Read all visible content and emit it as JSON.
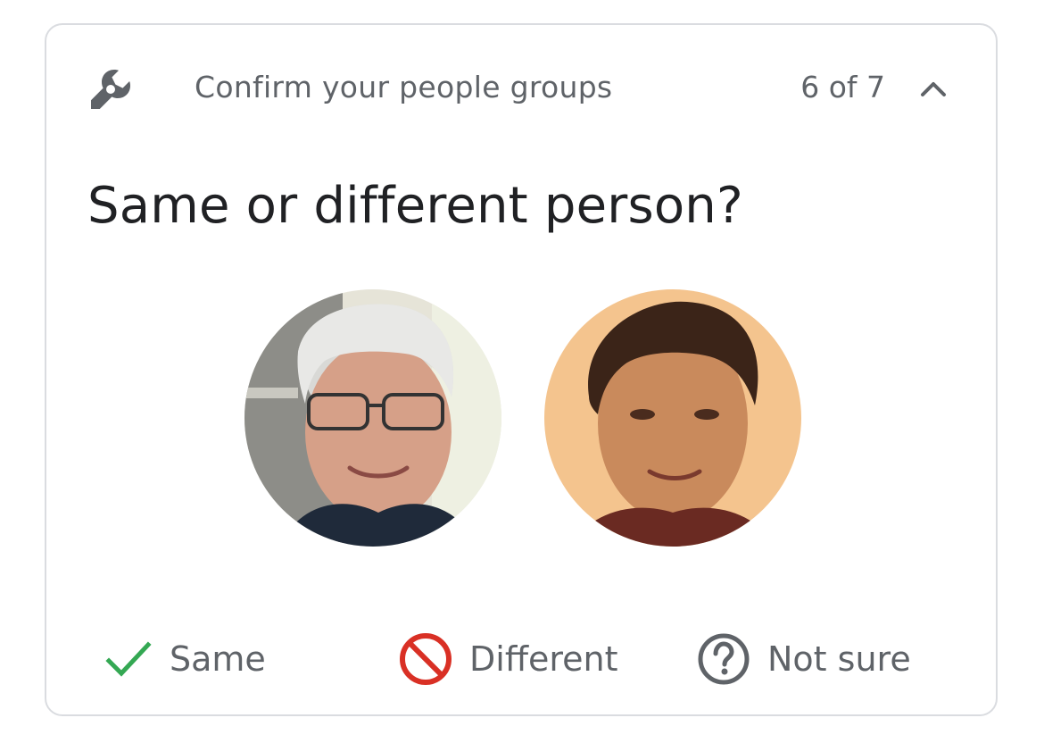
{
  "header": {
    "icon": "wrench-icon",
    "title": "Confirm your people groups",
    "counter": "6 of 7",
    "collapse_icon": "chevron-up-icon"
  },
  "question": "Same or different person?",
  "faces": [
    {
      "id": "face-older"
    },
    {
      "id": "face-younger"
    }
  ],
  "actions": {
    "same": {
      "label": "Same",
      "icon": "check-icon",
      "color": "#34a853"
    },
    "different": {
      "label": "Different",
      "icon": "block-icon",
      "color": "#d93025"
    },
    "not_sure": {
      "label": "Not sure",
      "icon": "help-circle-icon",
      "color": "#5f6368"
    }
  },
  "colors": {
    "text_primary": "#202124",
    "text_secondary": "#5f6368",
    "border": "#dadce0"
  }
}
